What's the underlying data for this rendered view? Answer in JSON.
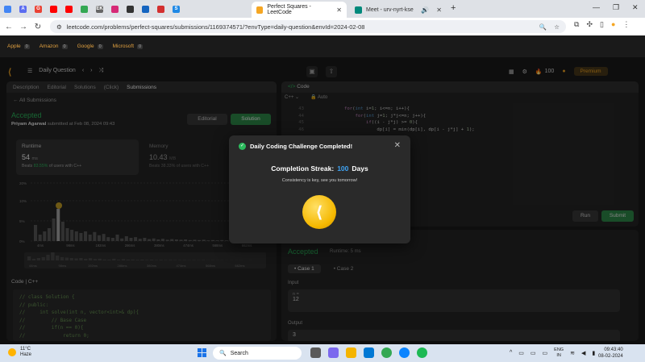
{
  "browser": {
    "active_tab": {
      "title": "Perfect Squares - LeetCode"
    },
    "other_tab": {
      "title": "Meet - urv-nyrt-kse"
    },
    "url": "leetcode.com/problems/perfect-squares/submissions/1169374571/?envType=daily-question&envId=2024-02-08",
    "mini_tabs": [
      {
        "icon": "chrome-icon",
        "color": "#4285f4",
        "text": ""
      },
      {
        "icon": "accounts-icon",
        "color": "#5b6cf0",
        "text": "A"
      },
      {
        "icon": "google-icon",
        "color": "#ea4335",
        "text": "G"
      },
      {
        "icon": "youtube-icon",
        "color": "#ff0000",
        "text": ""
      },
      {
        "icon": "youtube-icon",
        "color": "#ff0000",
        "text": ""
      },
      {
        "icon": "game-icon",
        "color": "#34a853",
        "text": ""
      },
      {
        "icon": "ek-icon",
        "color": "#666666",
        "text": "EK"
      },
      {
        "icon": "instagram-icon",
        "color": "#d62976",
        "text": ""
      },
      {
        "icon": "github-icon",
        "color": "#333333",
        "text": ""
      },
      {
        "icon": "gem-icon",
        "color": "#1565c0",
        "text": ""
      },
      {
        "icon": "gfg-icon",
        "color": "#d32f2f",
        "text": ""
      },
      {
        "icon": "s-icon",
        "color": "#1e88e5",
        "text": "S"
      }
    ]
  },
  "bookmarks": [
    {
      "label": "Apple",
      "count": "0"
    },
    {
      "label": "Amazon",
      "count": "0"
    },
    {
      "label": "Google",
      "count": "0"
    },
    {
      "label": "Microsoft",
      "count": "0"
    }
  ],
  "lc_top": {
    "daily_question": "Daily Question",
    "coins": "100",
    "premium": "Premium"
  },
  "left": {
    "tabs": {
      "description": "Description",
      "editorial": "Editorial",
      "solutions": "Solutions",
      "click": "(Click)",
      "submissions": "Submissions"
    },
    "back": "All Submissions",
    "status": "Accepted",
    "user": "Priyam Agarwal",
    "submitted": "submitted at Feb 08, 2024 09:43",
    "editorial_btn": "Editorial",
    "solution_btn": "Solution",
    "runtime": {
      "title": "Runtime",
      "value": "54",
      "unit": "ms",
      "beats_prefix": "Beats",
      "beats_pct": "83.55%",
      "beats_suffix": "of users with C++"
    },
    "memory": {
      "title": "Memory",
      "value": "10.43",
      "unit": "MB",
      "beats_text": "Beats 38.33% of users with C++"
    },
    "hist_y_labels": [
      "20%",
      "10%",
      "5%",
      "0%"
    ],
    "hist_x_labels": [
      "4ms",
      "98ms",
      "192ms",
      "286ms",
      "380ms",
      "474ms",
      "568ms",
      "662ms"
    ],
    "hist_x_labels_bottom": [
      "44ms",
      "98ms",
      "192ms",
      "286ms",
      "380ms",
      "474ms",
      "568ms",
      "662ms"
    ],
    "code_label": "Code | C++",
    "code_lines": [
      "// class Solution {",
      "// public:",
      "//     int solve(int n, vector<int>& dp){",
      "//         // Base Case",
      "//         if(n == 0){",
      "//             return 0;"
    ]
  },
  "right_top": {
    "header": "Code",
    "lang": "C++",
    "auto": "Auto",
    "line_numbers": [
      "43",
      "44",
      "45",
      "46"
    ],
    "run": "Run",
    "submit": "Submit"
  },
  "right_bot": {
    "status": "Accepted",
    "runtime": "Runtime: 5 ms",
    "case1": "Case 1",
    "case2": "Case 2",
    "input_label": "Input",
    "input_var": "n =",
    "input_val": "12",
    "output_label": "Output",
    "output_val": "3"
  },
  "modal": {
    "title": "Daily Coding Challenge Completed!",
    "streak_label": "Completion Streak:",
    "streak_num": "100",
    "streak_unit": "Days",
    "message": "Consistency is key, see you tomorrow!"
  },
  "taskbar": {
    "temp": "11°C",
    "weather": "Haze",
    "search": "Search",
    "lang1": "ENG",
    "lang2": "IN",
    "time": "09:43:40",
    "date": "08-02-2024"
  },
  "histogram": {
    "bars": [
      0.5,
      0.2,
      0.3,
      0.4,
      0.7,
      1.0,
      0.6,
      0.4,
      0.35,
      0.3,
      0.25,
      0.3,
      0.2,
      0.28,
      0.18,
      0.22,
      0.12,
      0.1,
      0.2,
      0.08,
      0.15,
      0.1,
      0.12,
      0.07,
      0.1,
      0.06,
      0.08,
      0.05,
      0.07,
      0.04,
      0.06,
      0.05,
      0.04,
      0.05,
      0.03,
      0.04,
      0.03,
      0.04,
      0.02,
      0.03,
      0.02,
      0.03,
      0.02,
      0.02,
      0.02,
      0.02,
      0.01,
      0.02,
      0.01,
      0.01
    ],
    "highlight_index": 5
  }
}
